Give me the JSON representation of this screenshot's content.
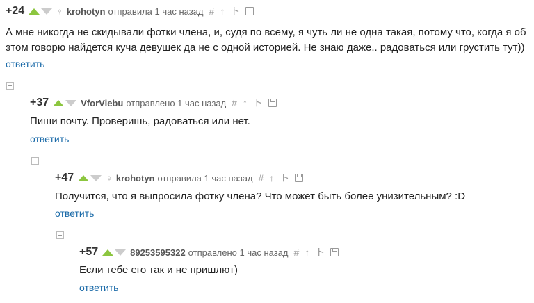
{
  "comments": [
    {
      "score": "+24",
      "gender_icon": "female-sign-icon",
      "author": "krohotyn",
      "action": "отправила 1 час назад",
      "text": "А мне никогда не скидывали фотки члена, и, судя по всему, я чуть ли не одна такая, потому что, когда я об этом говорю найдется куча девушек да не с одной историей. Не знаю даже.. радоваться или грустить тут))",
      "reply": "ответить"
    },
    {
      "score": "+37",
      "gender_icon": "",
      "author": "VforViebu",
      "action": "отправлено 1 час назад",
      "text": "Пиши почту. Проверишь, радоваться или нет.",
      "reply": "ответить"
    },
    {
      "score": "+47",
      "gender_icon": "female-sign-icon",
      "author": "krohotyn",
      "action": "отправила 1 час назад",
      "text": "Получится, что я выпросила фотку члена? Что может быть более унизительным? :D",
      "reply": "ответить"
    },
    {
      "score": "+57",
      "gender_icon": "",
      "author": "89253595322",
      "action": "отправлено 1 час назад",
      "text": "Если тебе его так и не пришлют)",
      "reply": "ответить"
    }
  ],
  "icons": {
    "tools": [
      "hash-link-icon",
      "parent-comment-icon",
      "thread-root-icon",
      "save-icon"
    ],
    "glyphs": {
      "hash": "#",
      "parent": "↑",
      "root": "ト",
      "female": "♀"
    }
  },
  "colors": {
    "vote_up": "#8cc63f",
    "vote_down": "#cccccc",
    "reply_link": "#1a6aa8"
  }
}
